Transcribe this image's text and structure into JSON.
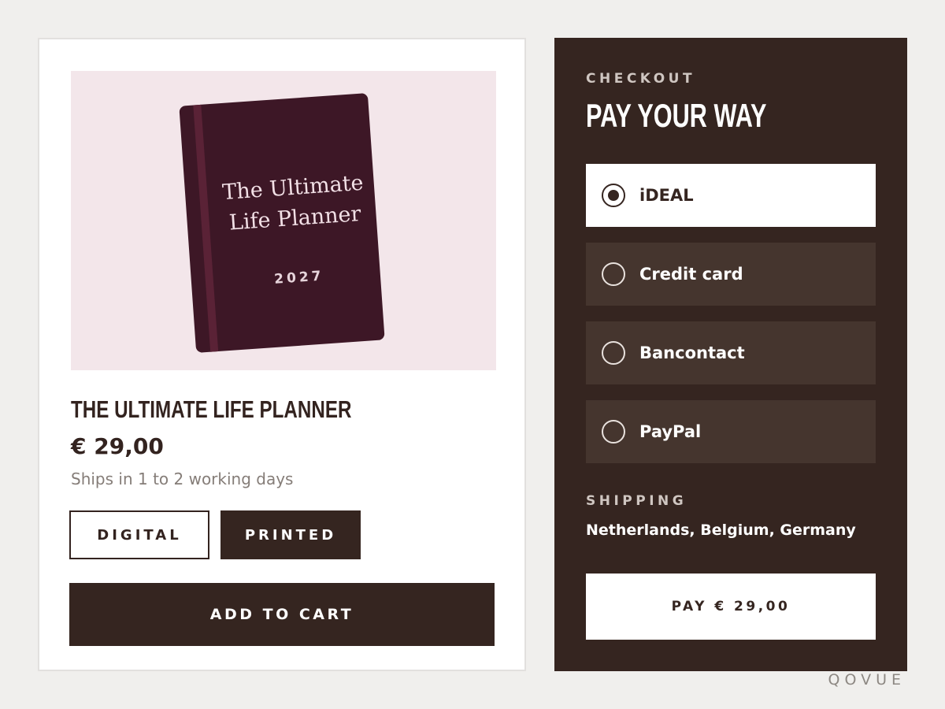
{
  "product": {
    "cover_title": "The Ultimate Life Planner",
    "cover_year": "2027",
    "title": "THE ULTIMATE LIFE PLANNER",
    "price": "€ 29,00",
    "shipping_note": "Ships in 1 to 2 working days",
    "formats": [
      {
        "label": "DIGITAL",
        "selected": false
      },
      {
        "label": "PRINTED",
        "selected": true
      }
    ],
    "add_to_cart_label": "ADD TO CART"
  },
  "checkout": {
    "eyebrow": "CHECKOUT",
    "title": "PAY YOUR WAY",
    "payment_methods": [
      {
        "label": "iDEAL",
        "selected": true
      },
      {
        "label": "Credit card",
        "selected": false
      },
      {
        "label": "Bancontact",
        "selected": false
      },
      {
        "label": "PayPal",
        "selected": false
      }
    ],
    "shipping_label": "SHIPPING",
    "shipping_countries": "Netherlands, Belgium, Germany",
    "pay_button_label": "PAY € 29,00"
  },
  "brand": "QOVUE",
  "colors": {
    "dark_brown": "#352520",
    "panel_option": "#45352e",
    "cover": "#3d1726",
    "image_bg": "#f3e6ea",
    "page_bg": "#f0efed"
  }
}
